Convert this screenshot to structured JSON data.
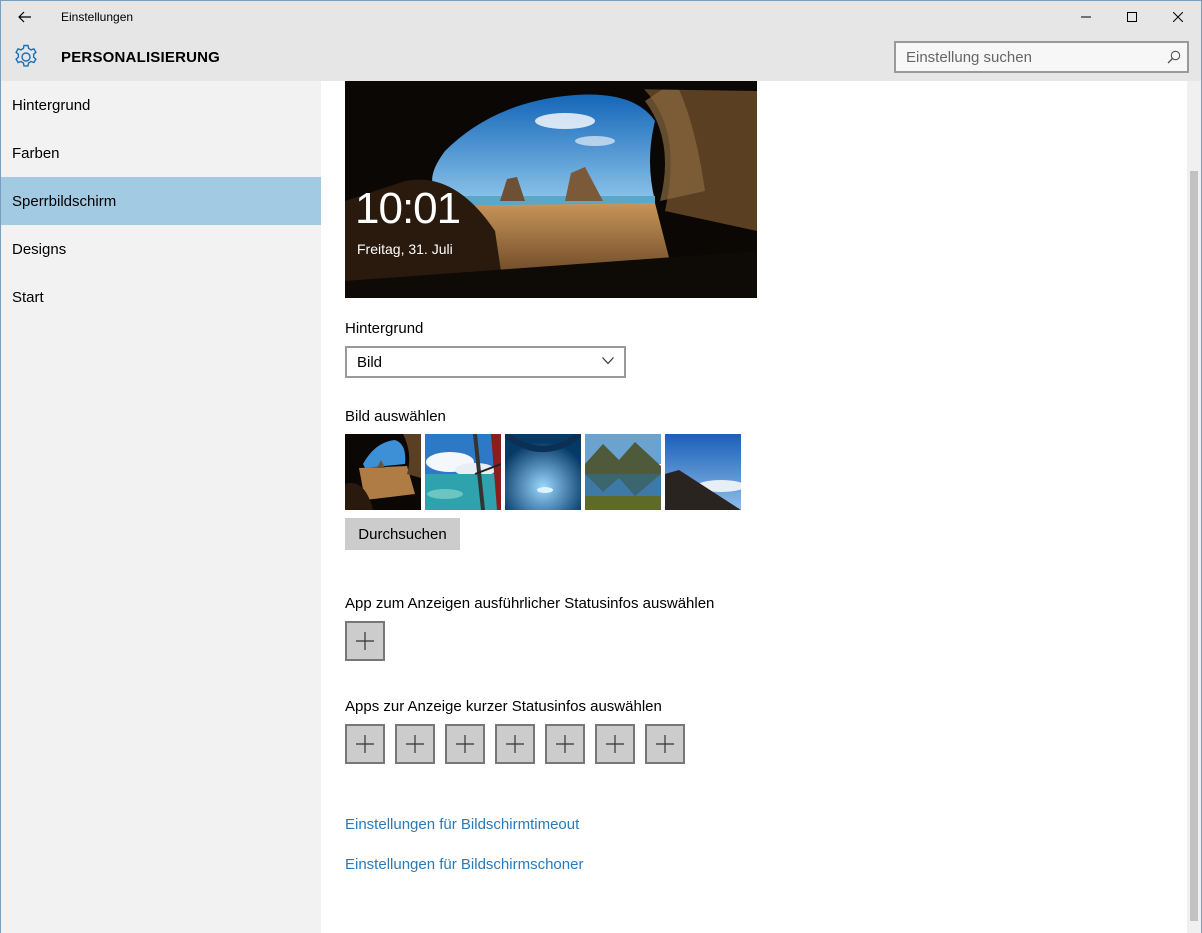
{
  "window": {
    "title": "Einstellungen",
    "back_icon": "arrow-left-icon",
    "minimize_icon": "minimize-icon",
    "maximize_icon": "maximize-icon",
    "close_icon": "close-icon"
  },
  "header": {
    "icon": "gear-icon",
    "title": "PERSONALISIERUNG",
    "search_placeholder": "Einstellung suchen",
    "search_value": "",
    "search_icon": "search-icon"
  },
  "sidebar": {
    "items": [
      {
        "label": "Hintergrund",
        "active": false
      },
      {
        "label": "Farben",
        "active": false
      },
      {
        "label": "Sperrbildschirm",
        "active": true
      },
      {
        "label": "Designs",
        "active": false
      },
      {
        "label": "Start",
        "active": false
      }
    ],
    "active_color": "#a3cae3"
  },
  "main": {
    "preview": {
      "time": "10:01",
      "date": "Freitag, 31. Juli"
    },
    "background_label": "Hintergrund",
    "background_select": "Bild",
    "choose_picture_label": "Bild auswählen",
    "thumbnails": [
      "cave-beach",
      "airplane-sky",
      "ice-cave",
      "mountain-lake",
      "mountain-ridge"
    ],
    "browse_label": "Durchsuchen",
    "detailed_status_label": "App zum Anzeigen ausführlicher Statusinfos auswählen",
    "quick_status_label": "Apps zur Anzeige kurzer Statusinfos auswählen",
    "plus_icon": "plus-icon",
    "quick_status_slots": 7,
    "link_timeout": "Einstellungen für Bildschirmtimeout",
    "link_screensaver": "Einstellungen für Bildschirmschoner",
    "link_color": "#2a7ab8"
  }
}
